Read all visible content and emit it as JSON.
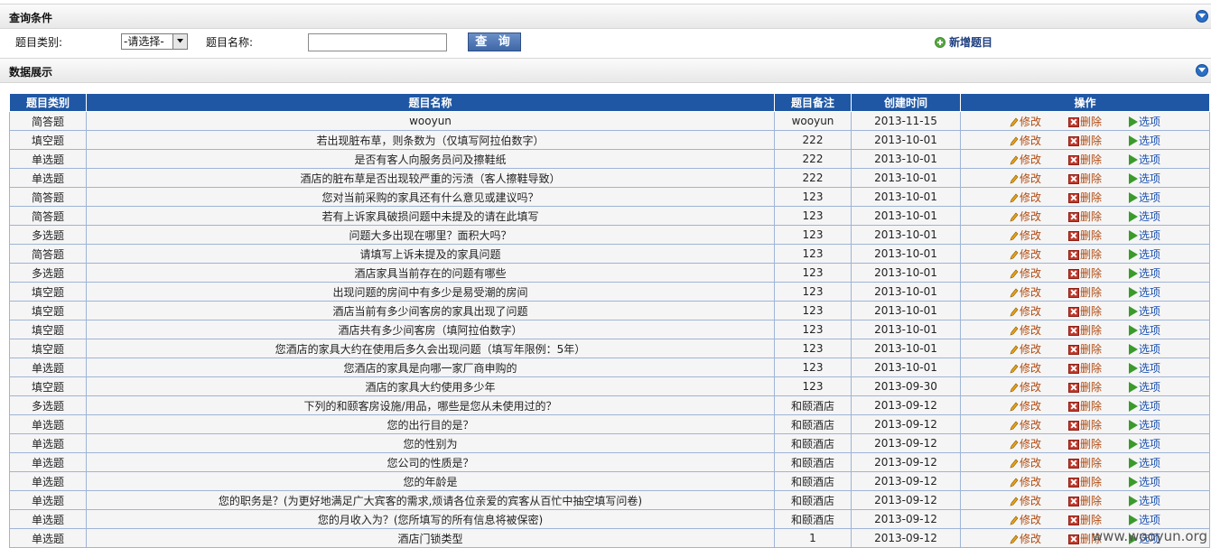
{
  "query_section": {
    "title": "查询条件",
    "category_label": "题目类别:",
    "category_selected": "-请选择-",
    "name_label": "题目名称:",
    "name_value": "",
    "query_button": "查 询",
    "add_link": "新增题目"
  },
  "data_section": {
    "title": "数据展示"
  },
  "table": {
    "columns": [
      "题目类别",
      "题目名称",
      "题目备注",
      "创建时间",
      "操作"
    ],
    "actions": {
      "edit": "修改",
      "delete": "删除",
      "options": "选项"
    },
    "rows": [
      {
        "category": "简答题",
        "name": "wooyun",
        "remark": "wooyun",
        "date": "2013-11-15"
      },
      {
        "category": "填空题",
        "name": "若出现脏布草，则条数为（仅填写阿拉伯数字）",
        "remark": "222",
        "date": "2013-10-01"
      },
      {
        "category": "单选题",
        "name": "是否有客人向服务员问及擦鞋纸",
        "remark": "222",
        "date": "2013-10-01"
      },
      {
        "category": "单选题",
        "name": "酒店的脏布草是否出现较严重的污渍（客人擦鞋导致）",
        "remark": "222",
        "date": "2013-10-01"
      },
      {
        "category": "简答题",
        "name": "您对当前采购的家具还有什么意见或建议吗？",
        "remark": "123",
        "date": "2013-10-01"
      },
      {
        "category": "简答题",
        "name": "若有上诉家具破损问题中未提及的请在此填写",
        "remark": "123",
        "date": "2013-10-01"
      },
      {
        "category": "多选题",
        "name": "问题大多出现在哪里？面积大吗？",
        "remark": "123",
        "date": "2013-10-01"
      },
      {
        "category": "简答题",
        "name": "请填写上诉未提及的家具问题",
        "remark": "123",
        "date": "2013-10-01"
      },
      {
        "category": "多选题",
        "name": "酒店家具当前存在的问题有哪些",
        "remark": "123",
        "date": "2013-10-01"
      },
      {
        "category": "填空题",
        "name": "出现问题的房间中有多少是易受潮的房间",
        "remark": "123",
        "date": "2013-10-01"
      },
      {
        "category": "填空题",
        "name": "酒店当前有多少间客房的家具出现了问题",
        "remark": "123",
        "date": "2013-10-01"
      },
      {
        "category": "填空题",
        "name": "酒店共有多少间客房（填阿拉伯数字）",
        "remark": "123",
        "date": "2013-10-01"
      },
      {
        "category": "填空题",
        "name": "您酒店的家具大约在使用后多久会出现问题（填写年限例：5年）",
        "remark": "123",
        "date": "2013-10-01"
      },
      {
        "category": "单选题",
        "name": "您酒店的家具是向哪一家厂商申购的",
        "remark": "123",
        "date": "2013-10-01"
      },
      {
        "category": "填空题",
        "name": "酒店的家具大约使用多少年",
        "remark": "123",
        "date": "2013-09-30"
      },
      {
        "category": "多选题",
        "name": "下列的和颐客房设施/用品，哪些是您从未使用过的？",
        "remark": "和颐酒店",
        "date": "2013-09-12"
      },
      {
        "category": "单选题",
        "name": "您的出行目的是？",
        "remark": "和颐酒店",
        "date": "2013-09-12"
      },
      {
        "category": "单选题",
        "name": "您的性别为",
        "remark": "和颐酒店",
        "date": "2013-09-12"
      },
      {
        "category": "单选题",
        "name": "您公司的性质是？",
        "remark": "和颐酒店",
        "date": "2013-09-12"
      },
      {
        "category": "单选题",
        "name": "您的年龄是",
        "remark": "和颐酒店",
        "date": "2013-09-12"
      },
      {
        "category": "单选题",
        "name": "您的职务是？(为更好地满足广大宾客的需求,烦请各位亲爱的宾客从百忙中抽空填写问卷)",
        "remark": "和颐酒店",
        "date": "2013-09-12"
      },
      {
        "category": "单选题",
        "name": "您的月收入为？(您所填写的所有信息将被保密)",
        "remark": "和颐酒店",
        "date": "2013-09-12"
      },
      {
        "category": "单选题",
        "name": "酒店门锁类型",
        "remark": "1",
        "date": "2013-09-12"
      }
    ]
  },
  "watermark": "www.wooyun.org"
}
